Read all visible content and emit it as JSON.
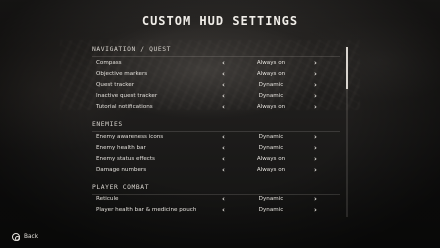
{
  "title": "CUSTOM HUD SETTINGS",
  "sections": [
    {
      "header": "NAVIGATION / QUEST",
      "rows": [
        {
          "label": "Compass",
          "value": "Always on"
        },
        {
          "label": "Objective markers",
          "value": "Always on"
        },
        {
          "label": "Quest tracker",
          "value": "Dynamic"
        },
        {
          "label": "Inactive quest tracker",
          "value": "Dynamic"
        },
        {
          "label": "Tutorial notifications",
          "value": "Always on"
        }
      ]
    },
    {
      "header": "ENEMIES",
      "rows": [
        {
          "label": "Enemy awareness icons",
          "value": "Dynamic"
        },
        {
          "label": "Enemy health bar",
          "value": "Dynamic"
        },
        {
          "label": "Enemy status effects",
          "value": "Always on"
        },
        {
          "label": "Damage numbers",
          "value": "Always on"
        }
      ]
    },
    {
      "header": "PLAYER COMBAT",
      "rows": [
        {
          "label": "Reticule",
          "value": "Dynamic"
        },
        {
          "label": "Player health bar & medicine pouch",
          "value": "Dynamic"
        }
      ]
    }
  ],
  "arrows": {
    "left": "‹",
    "right": "›"
  },
  "footer": {
    "button_icon": "circle-button-icon",
    "label": "Back"
  }
}
